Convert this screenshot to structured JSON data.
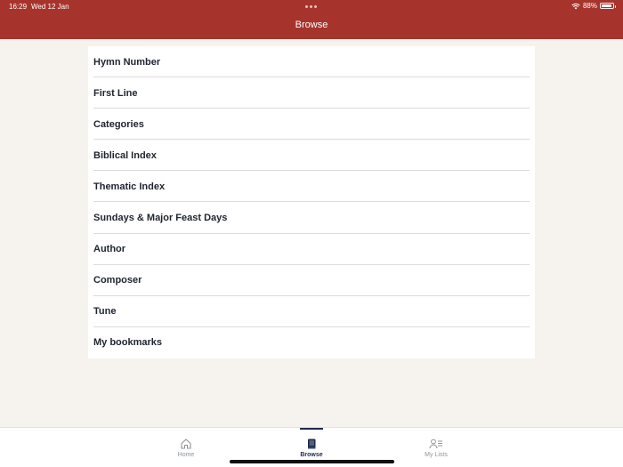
{
  "status_bar": {
    "time": "16:29",
    "date": "Wed 12 Jan",
    "battery": "88%",
    "battery_level": 0.88
  },
  "header": {
    "title": "Browse",
    "color": "#a6342d"
  },
  "browse_items": [
    {
      "label": "Hymn Number"
    },
    {
      "label": "First Line"
    },
    {
      "label": "Categories"
    },
    {
      "label": "Biblical Index"
    },
    {
      "label": "Thematic Index"
    },
    {
      "label": "Sundays & Major Feast Days"
    },
    {
      "label": "Author"
    },
    {
      "label": "Composer"
    },
    {
      "label": "Tune"
    },
    {
      "label": "My bookmarks"
    }
  ],
  "tabbar": {
    "tabs": [
      {
        "label": "Home",
        "icon": "home-icon"
      },
      {
        "label": "Browse",
        "icon": "book-icon",
        "selected": true
      },
      {
        "label": "My Lists",
        "icon": "user-list-icon"
      }
    ]
  }
}
